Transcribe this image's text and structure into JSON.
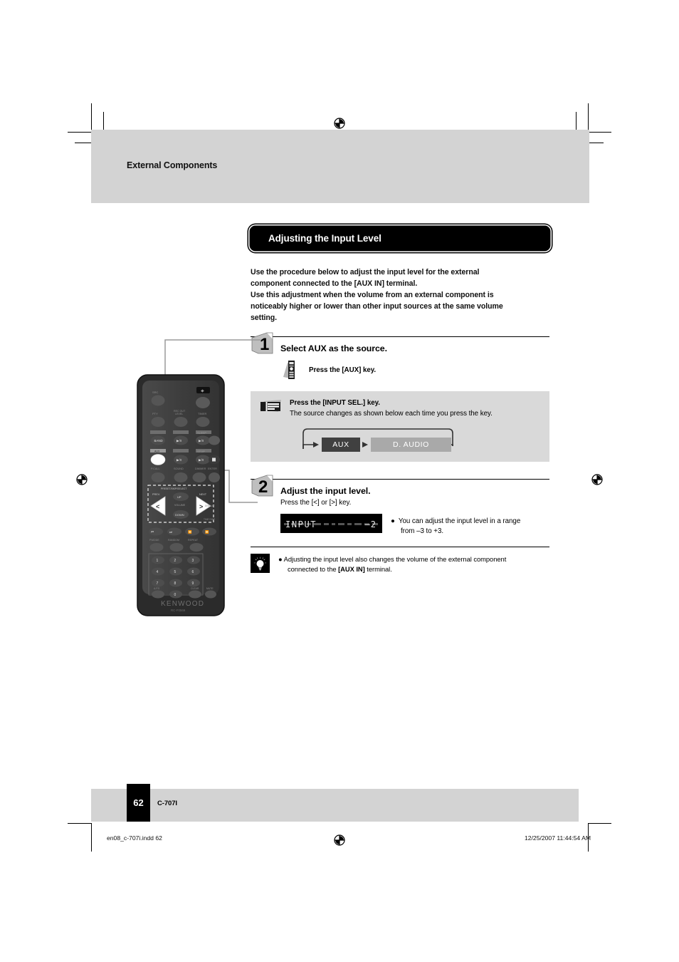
{
  "header": {
    "running_head": "External Components"
  },
  "section": {
    "title": "Adjusting the Input Level"
  },
  "intro": {
    "line1": "Use the procedure below to adjust the input level for the external",
    "line2": "component connected to the [AUX IN] terminal.",
    "line3": "Use this adjustment when the volume from an external component is",
    "line4": "noticeably higher or lower than other input sources at the same volume",
    "line5": "setting."
  },
  "steps": [
    {
      "number": "1",
      "title": "Select AUX as the source.",
      "remote_icon": "remote-control-icon",
      "remote_instruction": "Press the [AUX] key.",
      "panel_box": {
        "icon": "front-panel-icon",
        "instruction": "Press the [INPUT SEL.] key.",
        "note": "The source changes as shown below each time you press the key.",
        "cycle": [
          {
            "label": "AUX",
            "color": "#404040"
          },
          {
            "label": "D. AUDIO",
            "color": "#a9a9a9"
          }
        ]
      }
    },
    {
      "number": "2",
      "title": "Adjust the input level.",
      "instruction": "Press the [<] or [>] key.",
      "display": {
        "left": "INPUT",
        "right": "–2"
      },
      "bullet": {
        "line1": "You can adjust the input level in a range",
        "line2": "from –3 to +3."
      }
    }
  ],
  "tip": {
    "icon": "lightbulb-icon",
    "line1": "Adjusting the input level also changes the volume of the external component",
    "line2_pre": "connected to the ",
    "line2_bold": "[AUX IN]",
    "line2_post": " terminal."
  },
  "footer": {
    "page_number": "62",
    "model": "C-707I",
    "print_file": "en08_c-707i.indd   62",
    "print_date": "12/25/2007   11:44:54 AM"
  },
  "remote": {
    "brand": "KENWOOD",
    "model": "RC-F0569",
    "highlighted_keys": [
      "AUX",
      "left-arrow",
      "right-arrow"
    ],
    "keypad": [
      "1",
      "2",
      "3",
      "4",
      "5",
      "6",
      "7",
      "8",
      "9",
      "0"
    ]
  },
  "colors": {
    "band_gray": "#d3d3d3",
    "box_gray": "#d9d9d9",
    "aux_box": "#404040",
    "daudio_box": "#a9a9a9",
    "black": "#000000"
  }
}
